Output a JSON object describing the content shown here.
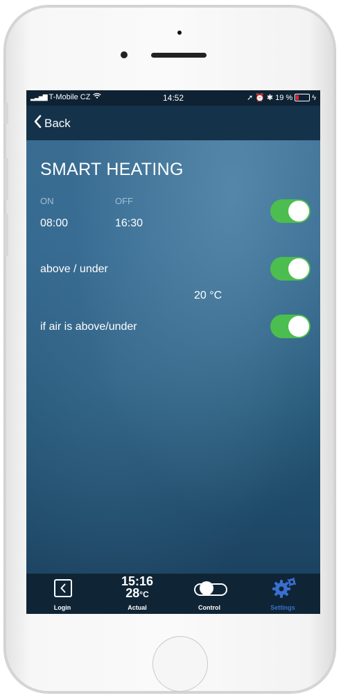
{
  "status_bar": {
    "carrier": "T-Mobile CZ",
    "time": "14:52",
    "battery": "19 %",
    "battery_level": 0.19,
    "battery_color": "#e5233a"
  },
  "nav": {
    "back_label": "Back"
  },
  "page": {
    "title": "SMART HEATING"
  },
  "schedule": {
    "on_label": "ON",
    "off_label": "OFF",
    "on_time": "08:00",
    "off_time": "16:30",
    "enabled": true
  },
  "threshold": {
    "label": "above / under",
    "value": "20 °C",
    "enabled": true
  },
  "air_condition": {
    "label": "if air is above/under",
    "enabled": true
  },
  "tabbar": {
    "login_label": "Login",
    "actual_time": "15:16",
    "actual_temp": "28",
    "actual_unit": "°C",
    "actual_label": "Actual",
    "control_label": "Control",
    "settings_label": "Settings"
  },
  "colors": {
    "toggle_on": "#4cbd4f",
    "active_tab": "#3a6fd0"
  },
  "icons": [
    "signal-icon",
    "wifi-icon",
    "location-icon",
    "alarm-icon",
    "bluetooth-icon",
    "battery-icon",
    "chevron-left-icon",
    "login-icon",
    "switch-icon",
    "gear-icon"
  ]
}
